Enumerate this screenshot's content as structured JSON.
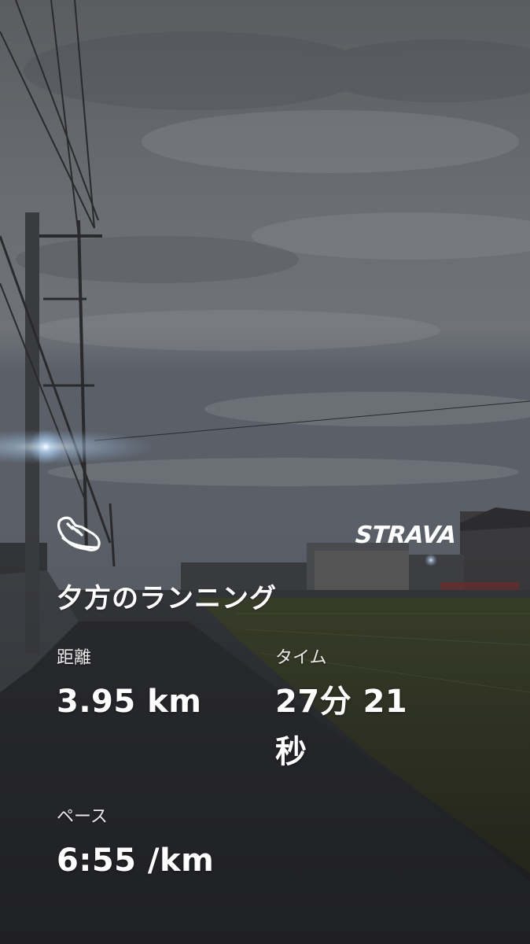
{
  "brand": {
    "name": "STRAVA"
  },
  "activity": {
    "icon": "running-shoe-icon",
    "title": "夕方のランニング"
  },
  "stats": {
    "distance": {
      "label": "距離",
      "value": "3.95 km"
    },
    "time": {
      "label": "タイム",
      "value_line1": "27分 21",
      "value_line2": "秒"
    },
    "pace": {
      "label": "ペース",
      "value": "6:55 /km"
    }
  },
  "colors": {
    "sky_top": "#5d6064",
    "sky_mid": "#73767c",
    "ground": "#2a2b30",
    "text": "#ffffff",
    "streetlight": "#cfe6ff"
  }
}
